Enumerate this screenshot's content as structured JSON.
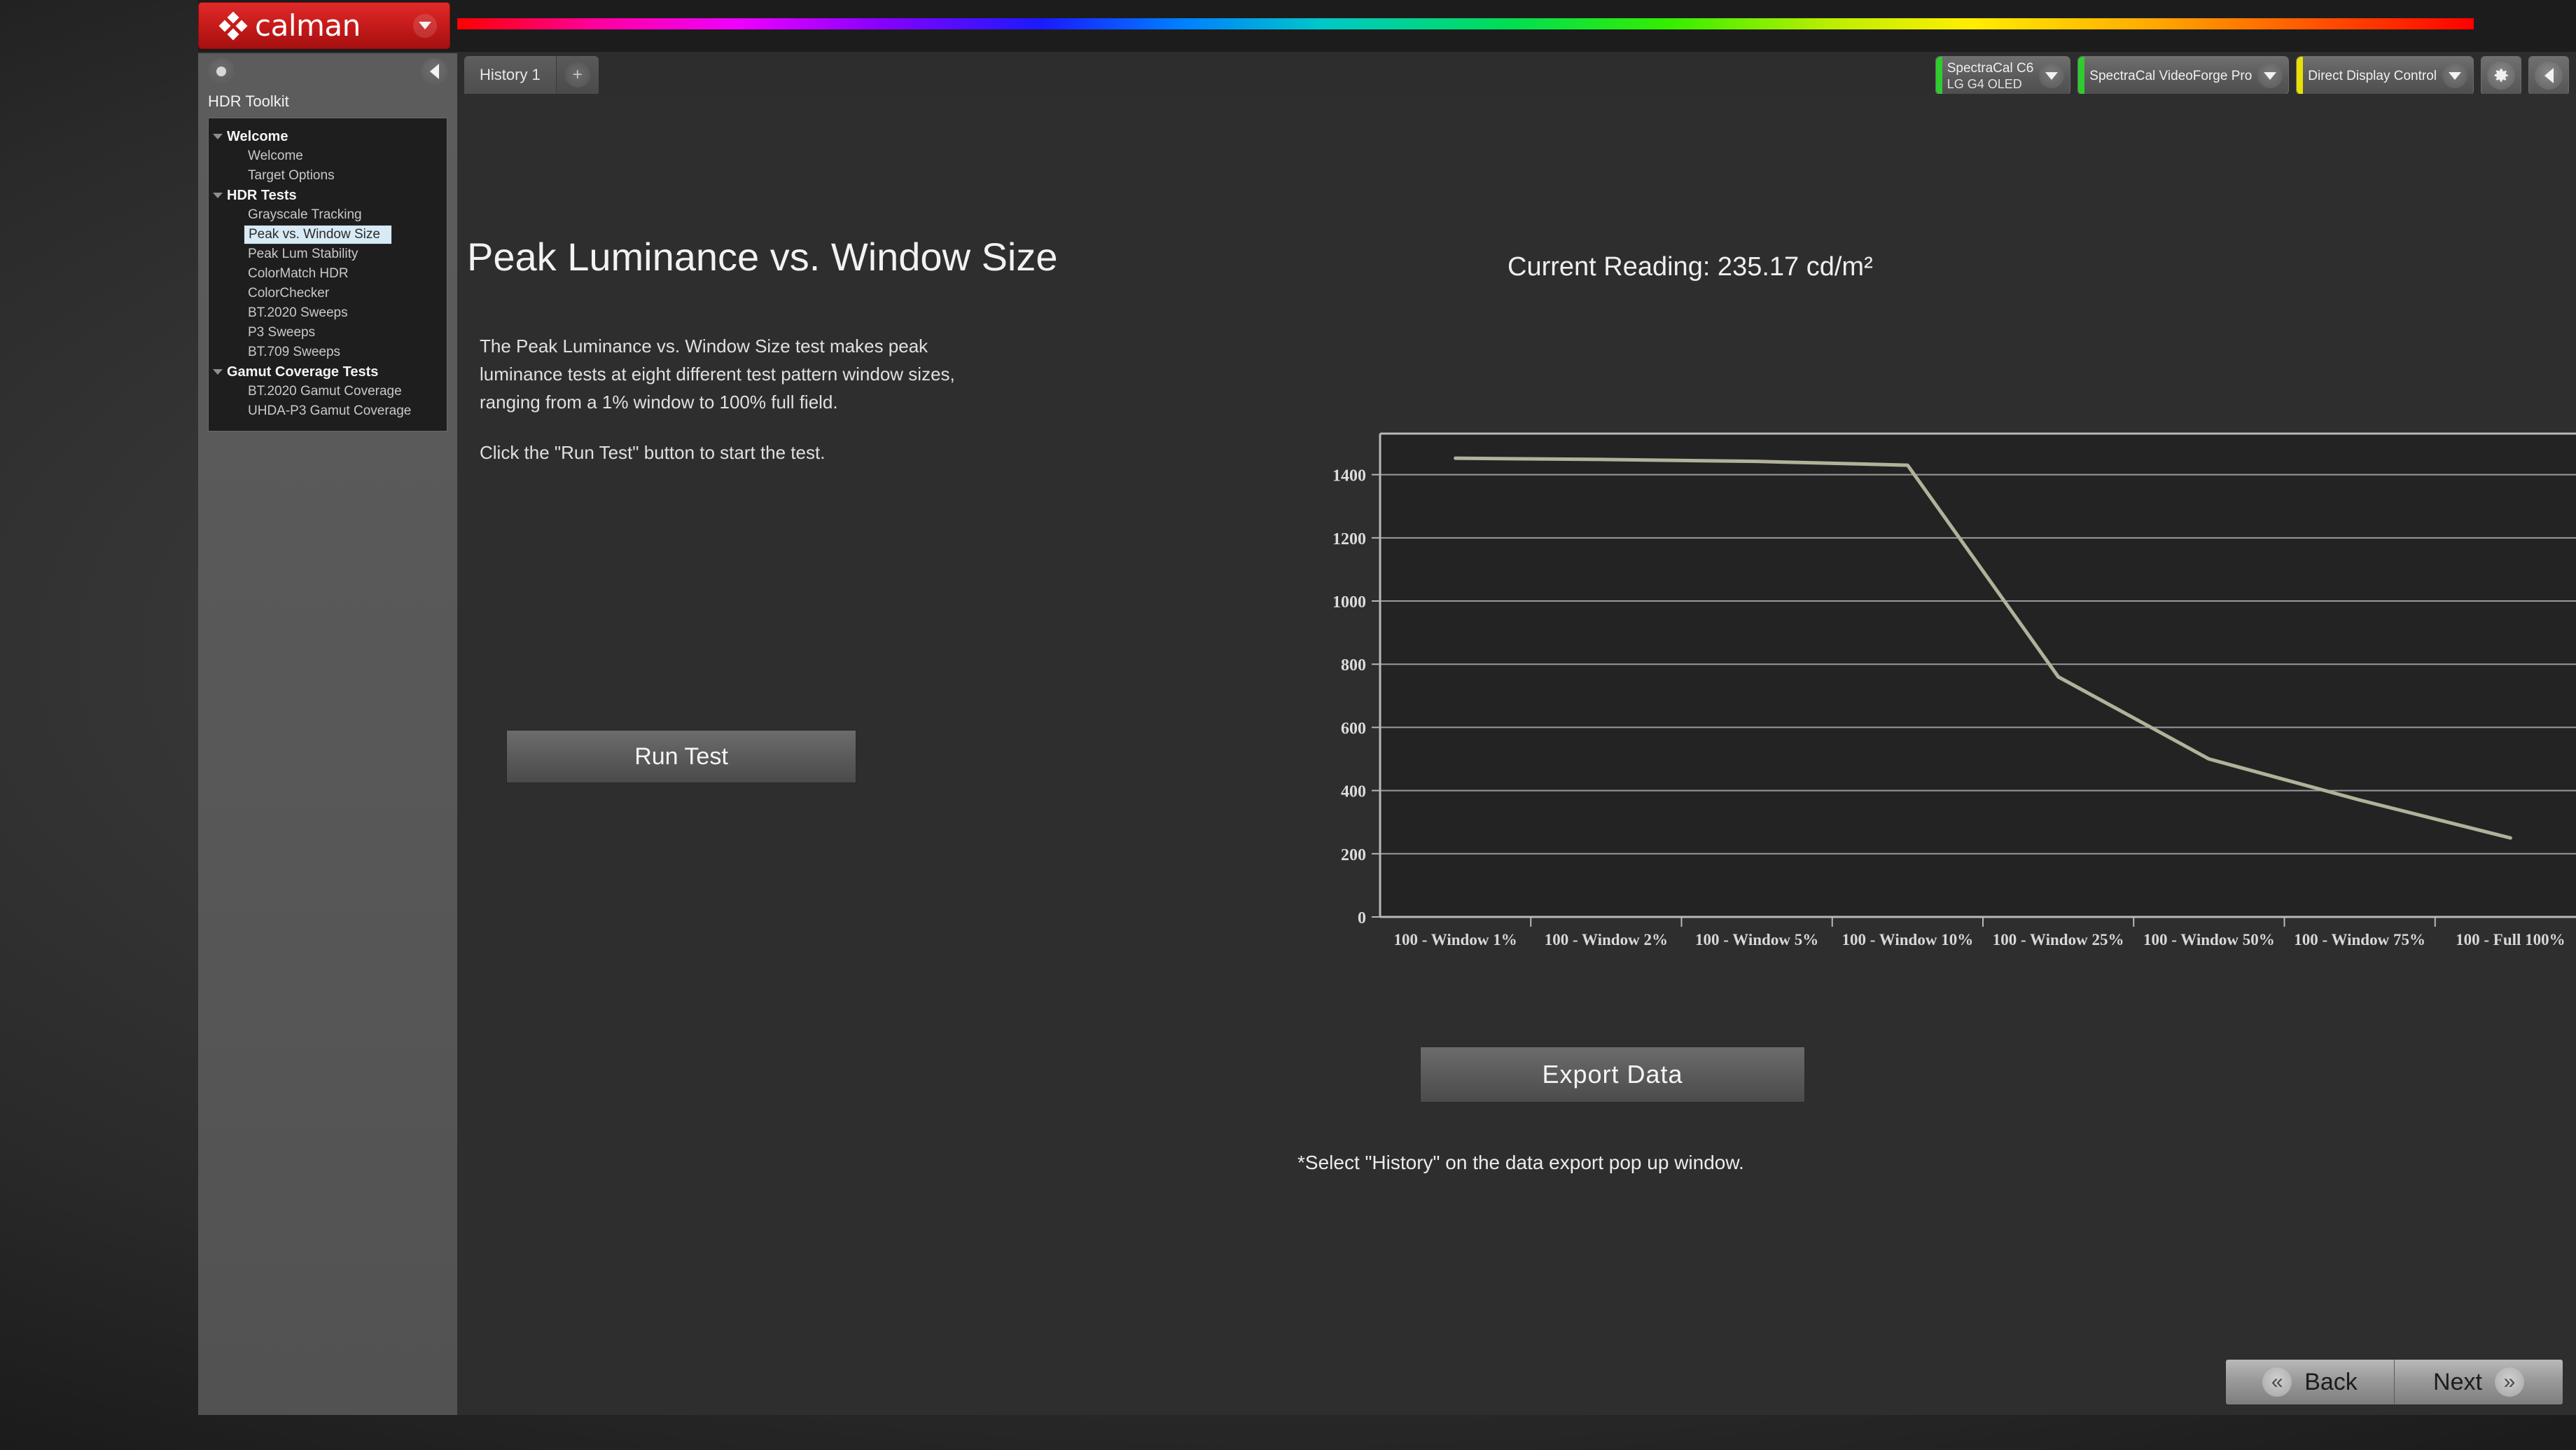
{
  "app": {
    "brand": "calman",
    "logo_caret_icon": "chevron-down-icon"
  },
  "tabs": {
    "items": [
      {
        "label": "History 1"
      }
    ],
    "add_label": "+"
  },
  "devices": [
    {
      "line1": "SpectraCal C6",
      "line2": "LG G4 OLED",
      "status_color": "#2ecc2e",
      "caret_icon": "chevron-down-icon"
    },
    {
      "line1": "SpectraCal VideoForge Pro",
      "line2": "",
      "status_color": "#2ecc2e",
      "caret_icon": "chevron-down-icon"
    },
    {
      "line1": "Direct Display Control",
      "line2": "",
      "status_color": "#e8e000",
      "caret_icon": "chevron-down-icon"
    }
  ],
  "toolbar": {
    "settings_icon": "gear-icon",
    "collapse_icon": "caret-left-icon"
  },
  "sidebar": {
    "title": "HDR Toolkit",
    "dot_icon": "record-dot-icon",
    "collapse_icon": "caret-left-icon",
    "groups": [
      {
        "label": "Welcome",
        "items": [
          {
            "label": "Welcome",
            "selected": false
          },
          {
            "label": "Target Options",
            "selected": false
          }
        ]
      },
      {
        "label": "HDR Tests",
        "items": [
          {
            "label": "Grayscale Tracking",
            "selected": false
          },
          {
            "label": "Peak vs. Window Size",
            "selected": true
          },
          {
            "label": "Peak Lum Stability",
            "selected": false
          },
          {
            "label": "ColorMatch HDR",
            "selected": false
          },
          {
            "label": "ColorChecker",
            "selected": false
          },
          {
            "label": "BT.2020 Sweeps",
            "selected": false
          },
          {
            "label": "P3 Sweeps",
            "selected": false
          },
          {
            "label": "BT.709 Sweeps",
            "selected": false
          }
        ]
      },
      {
        "label": "Gamut Coverage Tests",
        "items": [
          {
            "label": "BT.2020 Gamut Coverage",
            "selected": false
          },
          {
            "label": "UHDA-P3 Gamut Coverage",
            "selected": false
          }
        ]
      }
    ]
  },
  "main": {
    "page_title": "Peak Luminance vs. Window Size",
    "current_reading": "Current Reading: 235.17 cd/m²",
    "description_p1": "The Peak Luminance vs. Window Size test makes peak luminance tests at eight different test pattern window sizes, ranging from a 1% window to 100% full field.",
    "description_p2": "Click the \"Run Test\" button to start the test.",
    "run_test_label": "Run Test",
    "export_data_label": "Export  Data",
    "footnote": "*Select \"History\" on the data export pop up window."
  },
  "footer": {
    "back_label": "Back",
    "next_label": "Next",
    "back_icon": "chevron-double-left-icon",
    "next_icon": "chevron-double-right-icon",
    "back_glyph": "«",
    "next_glyph": "»"
  },
  "chart_data": {
    "type": "line",
    "title": "Peak Luminance vs. Window Size",
    "xlabel": "",
    "ylabel": "",
    "categories": [
      "100 - Window  1%",
      "100 - Window  2%",
      "100 - Window  5%",
      "100 - Window 10%",
      "100 - Window 25%",
      "100 - Window 50%",
      "100 - Window 75%",
      "100 - Full  100%"
    ],
    "values": [
      1452,
      1448,
      1442,
      1430,
      760,
      500,
      370,
      250
    ],
    "ylim": [
      0,
      1530
    ],
    "yticks": [
      0,
      200,
      400,
      600,
      800,
      1000,
      1200,
      1400
    ],
    "ytick_labels": [
      "0",
      "200",
      "400",
      "600",
      "800",
      "1000",
      "1200",
      "1400"
    ],
    "grid": true,
    "legend": false,
    "line_color": "#b2b29a",
    "plot_bg": "#232323",
    "axis_color": "#b8b8b8"
  }
}
